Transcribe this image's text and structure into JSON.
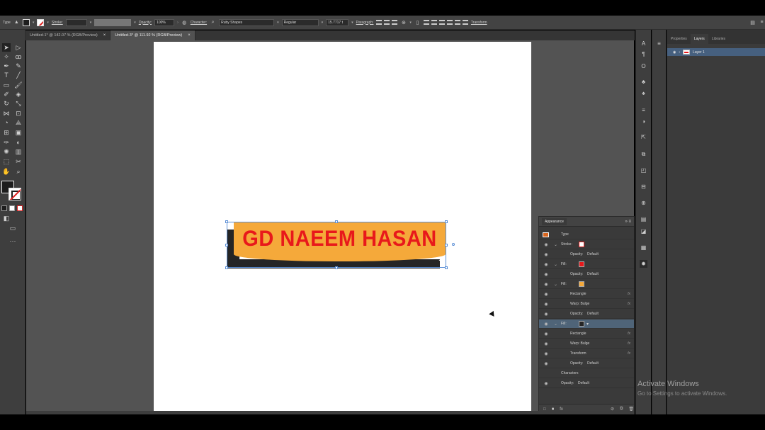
{
  "control_bar": {
    "type_label": "Type",
    "stroke_label": "Stroke:",
    "opacity_label": "Opacity:",
    "opacity_value": "100%",
    "character_label": "Character:",
    "font_family": "Ruby Shapes",
    "font_style": "Regular",
    "font_size": "15.7717 t",
    "paragraph_label": "Paragraph:",
    "transform_label": "Transform"
  },
  "tabs": [
    {
      "label": "Untitled-1* @ 142.07 % (RGB/Preview)"
    },
    {
      "label": "Untitled-3* @ 111.92 % (RGB/Preview)"
    }
  ],
  "artwork": {
    "text": "GD NAEEM HASAN",
    "colors": {
      "text": "#e8191b",
      "fill": "#f5a93a",
      "shadow": "#252525"
    }
  },
  "layers_panel": {
    "tabs": [
      "Properties",
      "Layers",
      "Libraries"
    ],
    "active_tab": "Layers",
    "layer_name": "Layer 1"
  },
  "appearance_panel": {
    "title": "Appearance",
    "rows": [
      {
        "label": "Type"
      },
      {
        "label": "Stroke:"
      },
      {
        "label": "Opacity:",
        "value": "Default"
      },
      {
        "label": "Fill:"
      },
      {
        "label": "Opacity:",
        "value": "Default"
      },
      {
        "label": "Fill:"
      },
      {
        "label": "Rectangle",
        "fx": "fx"
      },
      {
        "label": "Warp: Bulge",
        "fx": "fx"
      },
      {
        "label": "Opacity:",
        "value": "Default"
      },
      {
        "label": "Fill:"
      },
      {
        "label": "Rectangle",
        "fx": "fx"
      },
      {
        "label": "Warp: Bulge",
        "fx": "fx"
      },
      {
        "label": "Transform",
        "fx": "fx"
      },
      {
        "label": "Opacity:",
        "value": "Default"
      },
      {
        "label": "Characters"
      },
      {
        "label": "Opacity:",
        "value": "Default"
      }
    ]
  },
  "watermark": {
    "line1": "Activate Windows",
    "line2": "Go to Settings to activate Windows."
  }
}
